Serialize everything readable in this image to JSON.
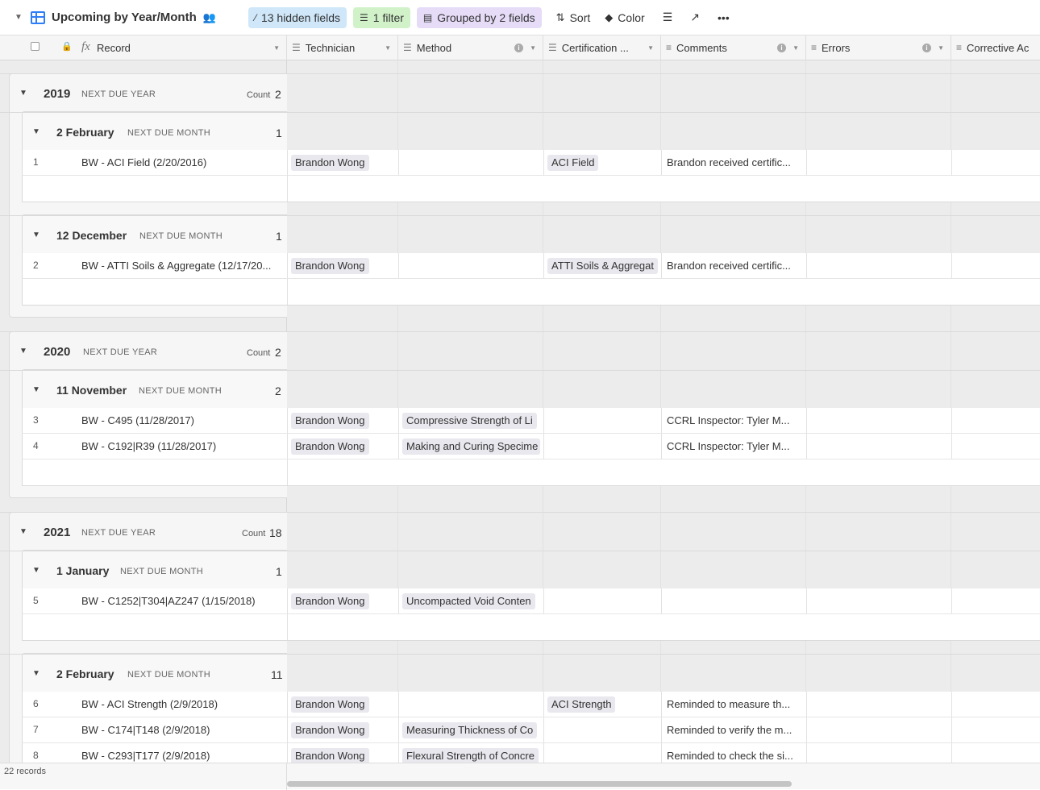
{
  "toolbar": {
    "view_title": "Upcoming by Year/Month",
    "hidden_fields": "13 hidden fields",
    "filter": "1 filter",
    "grouped": "Grouped by 2 fields",
    "sort": "Sort",
    "color": "Color"
  },
  "columns": {
    "record": "Record",
    "technician": "Technician",
    "method": "Method",
    "certification": "Certification ...",
    "comments": "Comments",
    "errors": "Errors",
    "corrective": "Corrective Ac"
  },
  "labels": {
    "next_due_year": "NEXT DUE YEAR",
    "next_due_month": "NEXT DUE MONTH",
    "count": "Count"
  },
  "groups": [
    {
      "year": "2019",
      "count": "2",
      "months": [
        {
          "name": "2 February",
          "count": "1"
        },
        {
          "name": "12 December",
          "count": "1"
        }
      ]
    },
    {
      "year": "2020",
      "count": "2",
      "months": [
        {
          "name": "11 November",
          "count": "2"
        }
      ]
    },
    {
      "year": "2021",
      "count": "18",
      "months": [
        {
          "name": "1 January",
          "count": "1"
        },
        {
          "name": "2 February",
          "count": "11"
        }
      ]
    }
  ],
  "records": [
    {
      "num": "1",
      "name": "BW - ACI Field (2/20/2016)",
      "technician": "Brandon Wong",
      "method": "",
      "certification": "ACI Field",
      "comments": "Brandon received certific..."
    },
    {
      "num": "2",
      "name": "BW - ATTI Soils & Aggregate (12/17/20...",
      "technician": "Brandon Wong",
      "method": "",
      "certification": "ATTI Soils & Aggregat",
      "comments": "Brandon received certific..."
    },
    {
      "num": "3",
      "name": "BW - C495 (11/28/2017)",
      "technician": "Brandon Wong",
      "method": "Compressive Strength of Li",
      "certification": "",
      "comments": "CCRL Inspector: Tyler M..."
    },
    {
      "num": "4",
      "name": "BW - C192|R39 (11/28/2017)",
      "technician": "Brandon Wong",
      "method": "Making and Curing Specime",
      "certification": "",
      "comments": "CCRL Inspector: Tyler M..."
    },
    {
      "num": "5",
      "name": "BW - C1252|T304|AZ247 (1/15/2018)",
      "technician": "Brandon Wong",
      "method": "Uncompacted Void Conten",
      "certification": "",
      "comments": ""
    },
    {
      "num": "6",
      "name": "BW - ACI Strength (2/9/2018)",
      "technician": "Brandon Wong",
      "method": "",
      "certification": "ACI Strength",
      "comments": "Reminded to measure th..."
    },
    {
      "num": "7",
      "name": "BW - C174|T148 (2/9/2018)",
      "technician": "Brandon Wong",
      "method": "Measuring Thickness of Co",
      "certification": "",
      "comments": "Reminded to verify the m..."
    },
    {
      "num": "8",
      "name": "BW - C293|T177 (2/9/2018)",
      "technician": "Brandon Wong",
      "method": "Flexural Strength of Concre",
      "certification": "",
      "comments": "Reminded to check the si..."
    }
  ],
  "footer": {
    "record_count": "22 records"
  }
}
